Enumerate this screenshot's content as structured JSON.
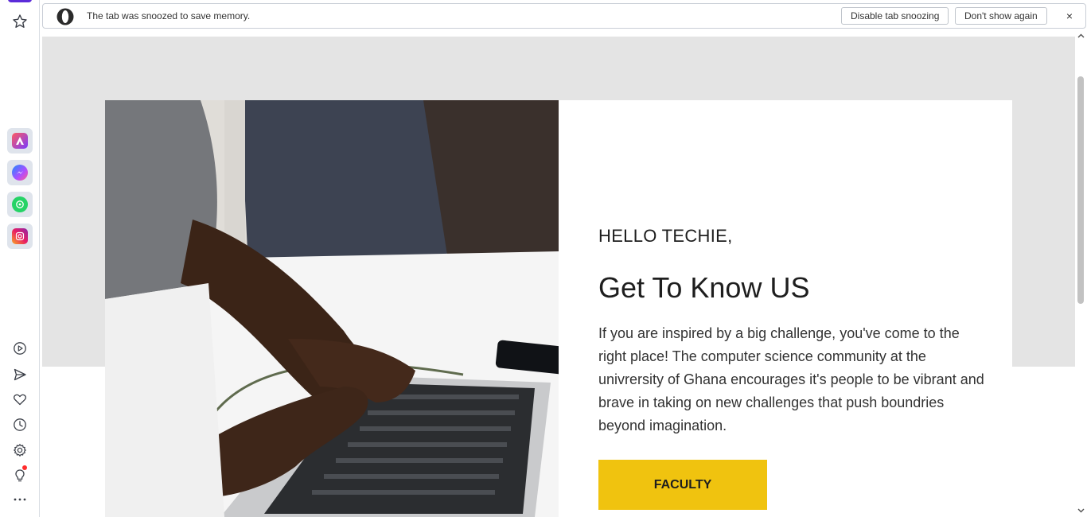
{
  "sidebar": {
    "icons": {
      "star": "star-icon",
      "aria": "aria-icon",
      "messenger": "messenger-icon",
      "whatsapp": "whatsapp-icon",
      "instagram": "instagram-icon",
      "player": "player-icon",
      "send": "send-icon",
      "heart": "heart-icon",
      "history": "history-icon",
      "settings": "gear-icon",
      "tips": "lightbulb-icon",
      "more": "more-icon"
    },
    "accent_color": "#5b2bd9"
  },
  "snooze_bar": {
    "message": "The tab was snoozed to save memory.",
    "disable_label": "Disable tab snoozing",
    "dont_show_label": "Don't show again",
    "close_label": "×"
  },
  "page": {
    "greeting": "HELLO TECHIE,",
    "heading": "Get To Know US",
    "body": "If you are inspired by a big challenge, you've come to the right place! The computer science community at the univrersity of Ghana encourages it's people to be vibrant and brave in taking on new challenges that push boundries beyond imagination.",
    "button_label": "FACULTY",
    "button_color": "#f0c30f",
    "band_color": "#e4e4e4"
  }
}
